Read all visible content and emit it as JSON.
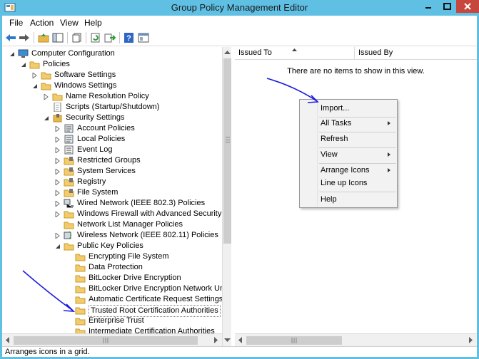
{
  "window": {
    "title": "Group Policy Management Editor"
  },
  "menu": {
    "items": [
      "File",
      "Action",
      "View",
      "Help"
    ]
  },
  "toolbar": {
    "buttons": [
      "back-arrow-icon",
      "forward-arrow-icon",
      "up-folder-icon",
      "show-hide-tree-icon",
      "copy-icon",
      "refresh-icon",
      "export-list-icon",
      "help-icon",
      "properties-icon"
    ]
  },
  "tree": {
    "items": [
      {
        "label": "Computer Configuration",
        "icon": "computer-icon"
      },
      {
        "label": "Policies",
        "icon": "folder-icon"
      },
      {
        "label": "Software Settings",
        "icon": "folder-icon"
      },
      {
        "label": "Windows Settings",
        "icon": "folder-icon"
      },
      {
        "label": "Name Resolution Policy",
        "icon": "folder-icon"
      },
      {
        "label": "Scripts (Startup/Shutdown)",
        "icon": "script-icon"
      },
      {
        "label": "Security Settings",
        "icon": "security-icon"
      },
      {
        "label": "Account Policies",
        "icon": "policy-icon"
      },
      {
        "label": "Local Policies",
        "icon": "policy-icon"
      },
      {
        "label": "Event Log",
        "icon": "event-log-icon"
      },
      {
        "label": "Restricted Groups",
        "icon": "locked-folder-icon"
      },
      {
        "label": "System Services",
        "icon": "locked-folder-icon"
      },
      {
        "label": "Registry",
        "icon": "locked-folder-icon"
      },
      {
        "label": "File System",
        "icon": "locked-folder-icon"
      },
      {
        "label": "Wired Network (IEEE 802.3) Policies",
        "icon": "network-icon"
      },
      {
        "label": "Windows Firewall with Advanced Security",
        "icon": "folder-icon"
      },
      {
        "label": "Network List Manager Policies",
        "icon": "folder-icon"
      },
      {
        "label": "Wireless Network (IEEE 802.11) Policies",
        "icon": "wireless-icon"
      },
      {
        "label": "Public Key Policies",
        "icon": "folder-icon"
      },
      {
        "label": "Encrypting File System",
        "icon": "folder-icon"
      },
      {
        "label": "Data Protection",
        "icon": "folder-icon"
      },
      {
        "label": "BitLocker Drive Encryption",
        "icon": "folder-icon"
      },
      {
        "label": "BitLocker Drive Encryption Network Unloc",
        "icon": "folder-icon"
      },
      {
        "label": "Automatic Certificate Request Settings",
        "icon": "folder-icon"
      },
      {
        "label": "Trusted Root Certification Authorities",
        "icon": "folder-icon"
      },
      {
        "label": "Enterprise Trust",
        "icon": "folder-icon"
      },
      {
        "label": "Intermediate Certification Authorities",
        "icon": "folder-icon"
      }
    ]
  },
  "list": {
    "columns": [
      "Issued To",
      "Issued By"
    ],
    "empty_message": "There are no items to show in this view."
  },
  "context_menu": {
    "items": [
      "Import...",
      "All Tasks",
      "Refresh",
      "View",
      "Arrange Icons",
      "Line up Icons",
      "Help"
    ]
  },
  "status": {
    "text": "Arranges icons in a grid."
  },
  "colors": {
    "title_bar": "#5fc0e4",
    "close_button": "#c7463d",
    "annotation_ink": "#1a1adf"
  }
}
